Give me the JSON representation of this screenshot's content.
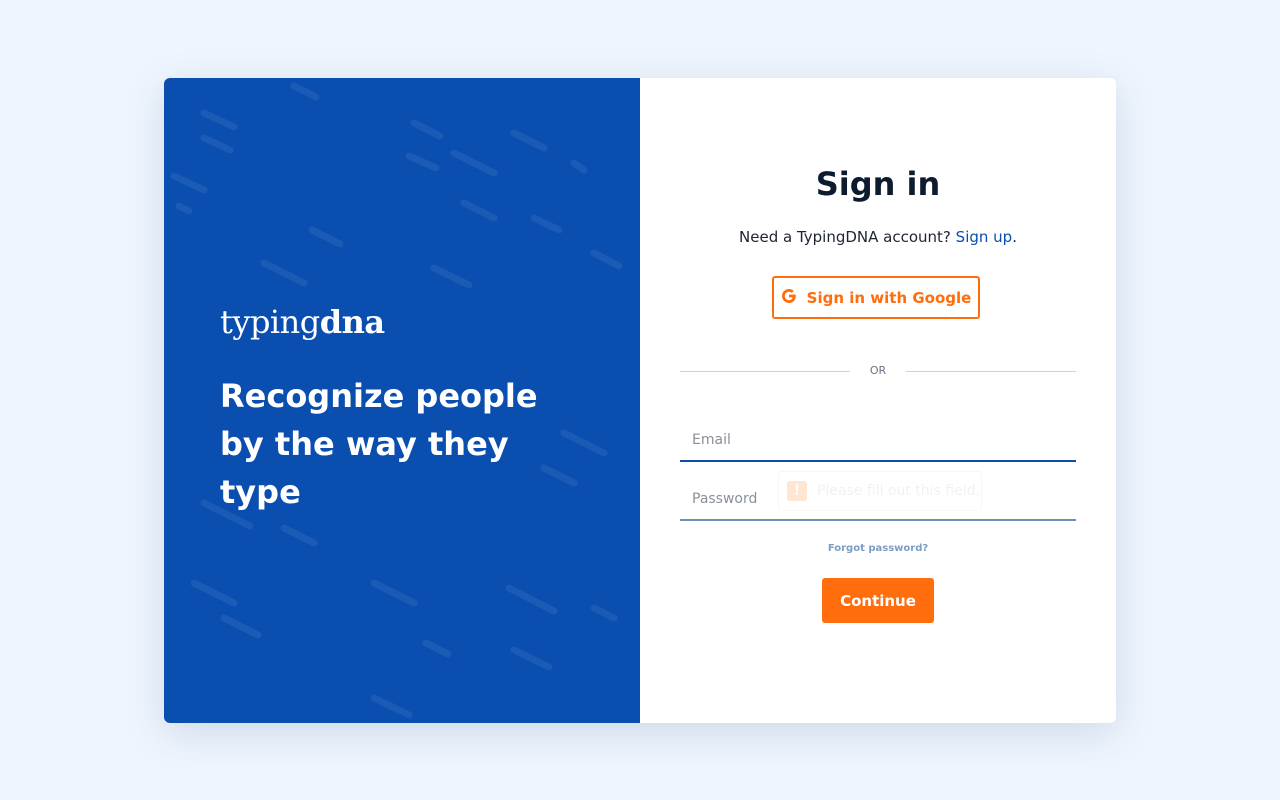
{
  "brand": {
    "logo_light": "typing",
    "logo_bold": "dna",
    "tagline": "Recognize people by the way they type",
    "panel_color": "#0a4eb0"
  },
  "signin": {
    "title": "Sign in",
    "need_account_text": "Need a TypingDNA account?",
    "signup_link": "Sign up",
    "signup_suffix": ".",
    "google_button_label": "Sign in with Google",
    "google_icon": "google-g-icon",
    "divider_text": "OR",
    "email_placeholder": "Email",
    "email_value": "",
    "password_placeholder": "Password",
    "password_value": "",
    "validation_message": "Please fill out this field.",
    "validation_icon": "!",
    "forgot_password": "Forgot password?",
    "continue_label": "Continue",
    "accent_color": "#ff6d0c"
  }
}
